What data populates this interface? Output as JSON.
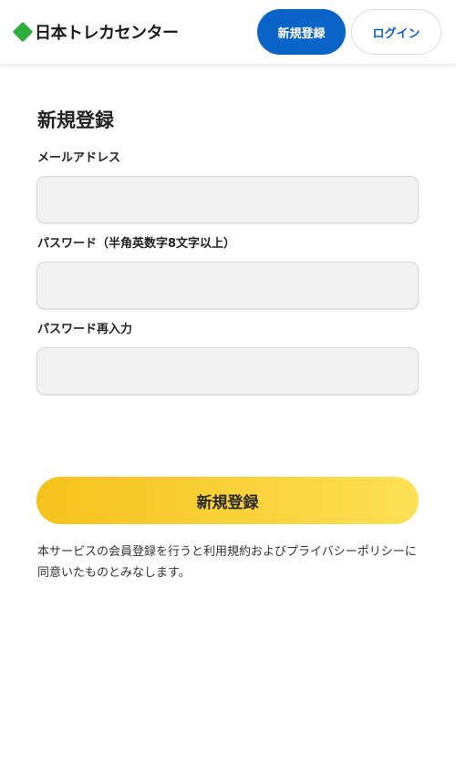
{
  "header": {
    "logo_text": "日本トレカセンター",
    "register_label": "新規登録",
    "login_label": "ログイン"
  },
  "form": {
    "title": "新規登録",
    "email": {
      "label": "メールアドレス",
      "value": ""
    },
    "password": {
      "label": "パスワード（半角英数字8文字以上）",
      "value": ""
    },
    "password_confirm": {
      "label": "パスワード再入力",
      "value": ""
    },
    "submit_label": "新規登録"
  },
  "notice": "本サービスの会員登録を行うと利用規約およびプライバシーポリシーに同意いたものとみなします。",
  "colors": {
    "brand_blue": "#0a64c8",
    "logo_green": "#2fae3b",
    "submit_yellow_start": "#f5c21c",
    "submit_yellow_end": "#fde055"
  },
  "icons": {
    "logo": "green-diamond-icon"
  }
}
